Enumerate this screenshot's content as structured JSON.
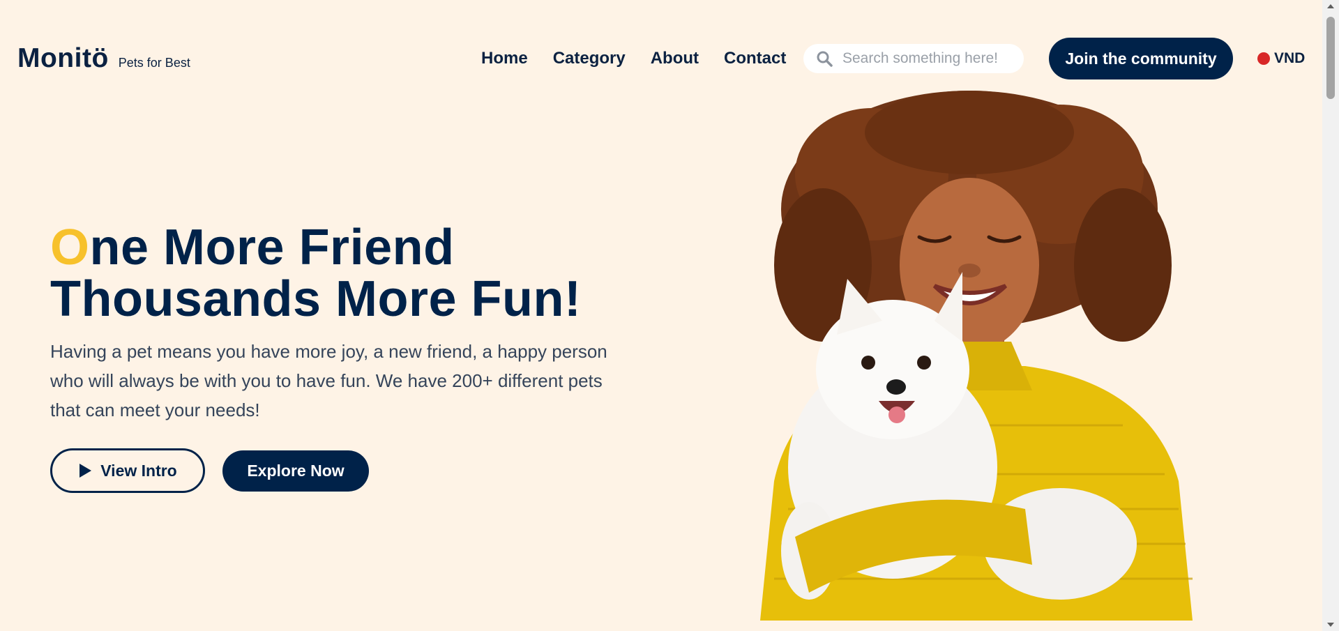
{
  "header": {
    "logo": "Monitö",
    "tagline": "Pets for Best",
    "nav": [
      "Home",
      "Category",
      "About",
      "Contact"
    ],
    "search_placeholder": "Search something here!",
    "join_label": "Join the community",
    "currency": "VND"
  },
  "hero": {
    "title_first_letter": "O",
    "title_line1_rest": "ne More Friend",
    "title_line2": "Thousands More Fun!",
    "description": "Having a pet means you have more joy, a new friend, a happy person who will always be with you to have fun. We have 200+ different pets that can meet your needs!",
    "view_intro_label": "View Intro",
    "explore_label": "Explore Now"
  },
  "colors": {
    "background": "#fef3e6",
    "primary": "#002249",
    "accent": "#f7c12b",
    "currency_dot": "#d82727"
  },
  "icons": {
    "search": "search-icon",
    "play": "play-icon"
  }
}
